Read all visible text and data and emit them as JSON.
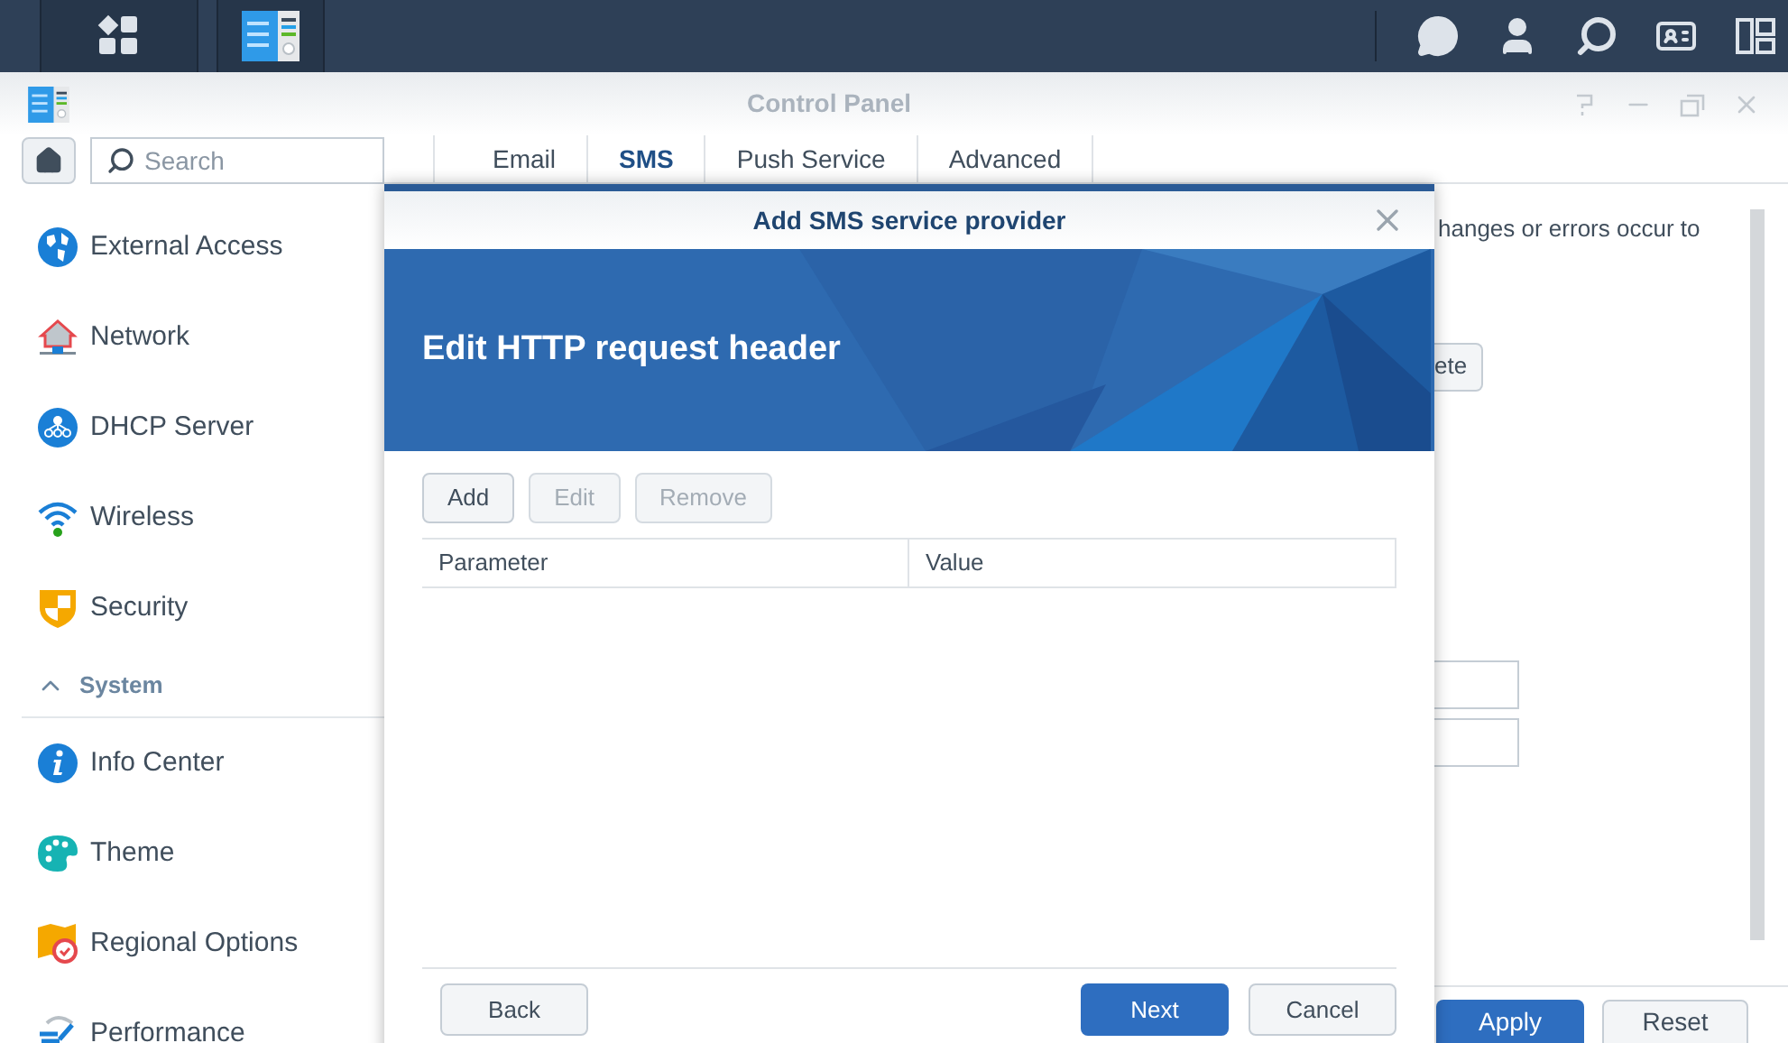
{
  "window": {
    "title": "Control Panel"
  },
  "search": {
    "placeholder": "Search"
  },
  "tabs": [
    {
      "label": "Email",
      "selected": false
    },
    {
      "label": "SMS",
      "selected": true
    },
    {
      "label": "Push Service",
      "selected": false
    },
    {
      "label": "Advanced",
      "selected": false
    }
  ],
  "sidebar": {
    "items": [
      {
        "kind": "item",
        "label": "External Access"
      },
      {
        "kind": "item",
        "label": "Network"
      },
      {
        "kind": "item",
        "label": "DHCP Server"
      },
      {
        "kind": "item",
        "label": "Wireless"
      },
      {
        "kind": "item",
        "label": "Security"
      },
      {
        "kind": "section",
        "label": "System",
        "expanded": true
      },
      {
        "kind": "item",
        "label": "Info Center"
      },
      {
        "kind": "item",
        "label": "Theme"
      },
      {
        "kind": "item",
        "label": "Regional Options"
      },
      {
        "kind": "item",
        "label": "Performance"
      }
    ]
  },
  "background": {
    "text": "hanges or errors occur to",
    "button": "ete",
    "apply": "Apply",
    "reset": "Reset"
  },
  "dialog": {
    "title": "Add SMS service provider",
    "heading": "Edit HTTP request header",
    "toolbar": [
      {
        "label": "Add",
        "disabled": false
      },
      {
        "label": "Edit",
        "disabled": true
      },
      {
        "label": "Remove",
        "disabled": true
      }
    ],
    "columns": [
      "Parameter",
      "Value"
    ],
    "footer": [
      {
        "label": "Back",
        "kind": "plain"
      },
      {
        "label": "Next",
        "kind": "primary"
      },
      {
        "label": "Cancel",
        "kind": "plain"
      }
    ]
  }
}
